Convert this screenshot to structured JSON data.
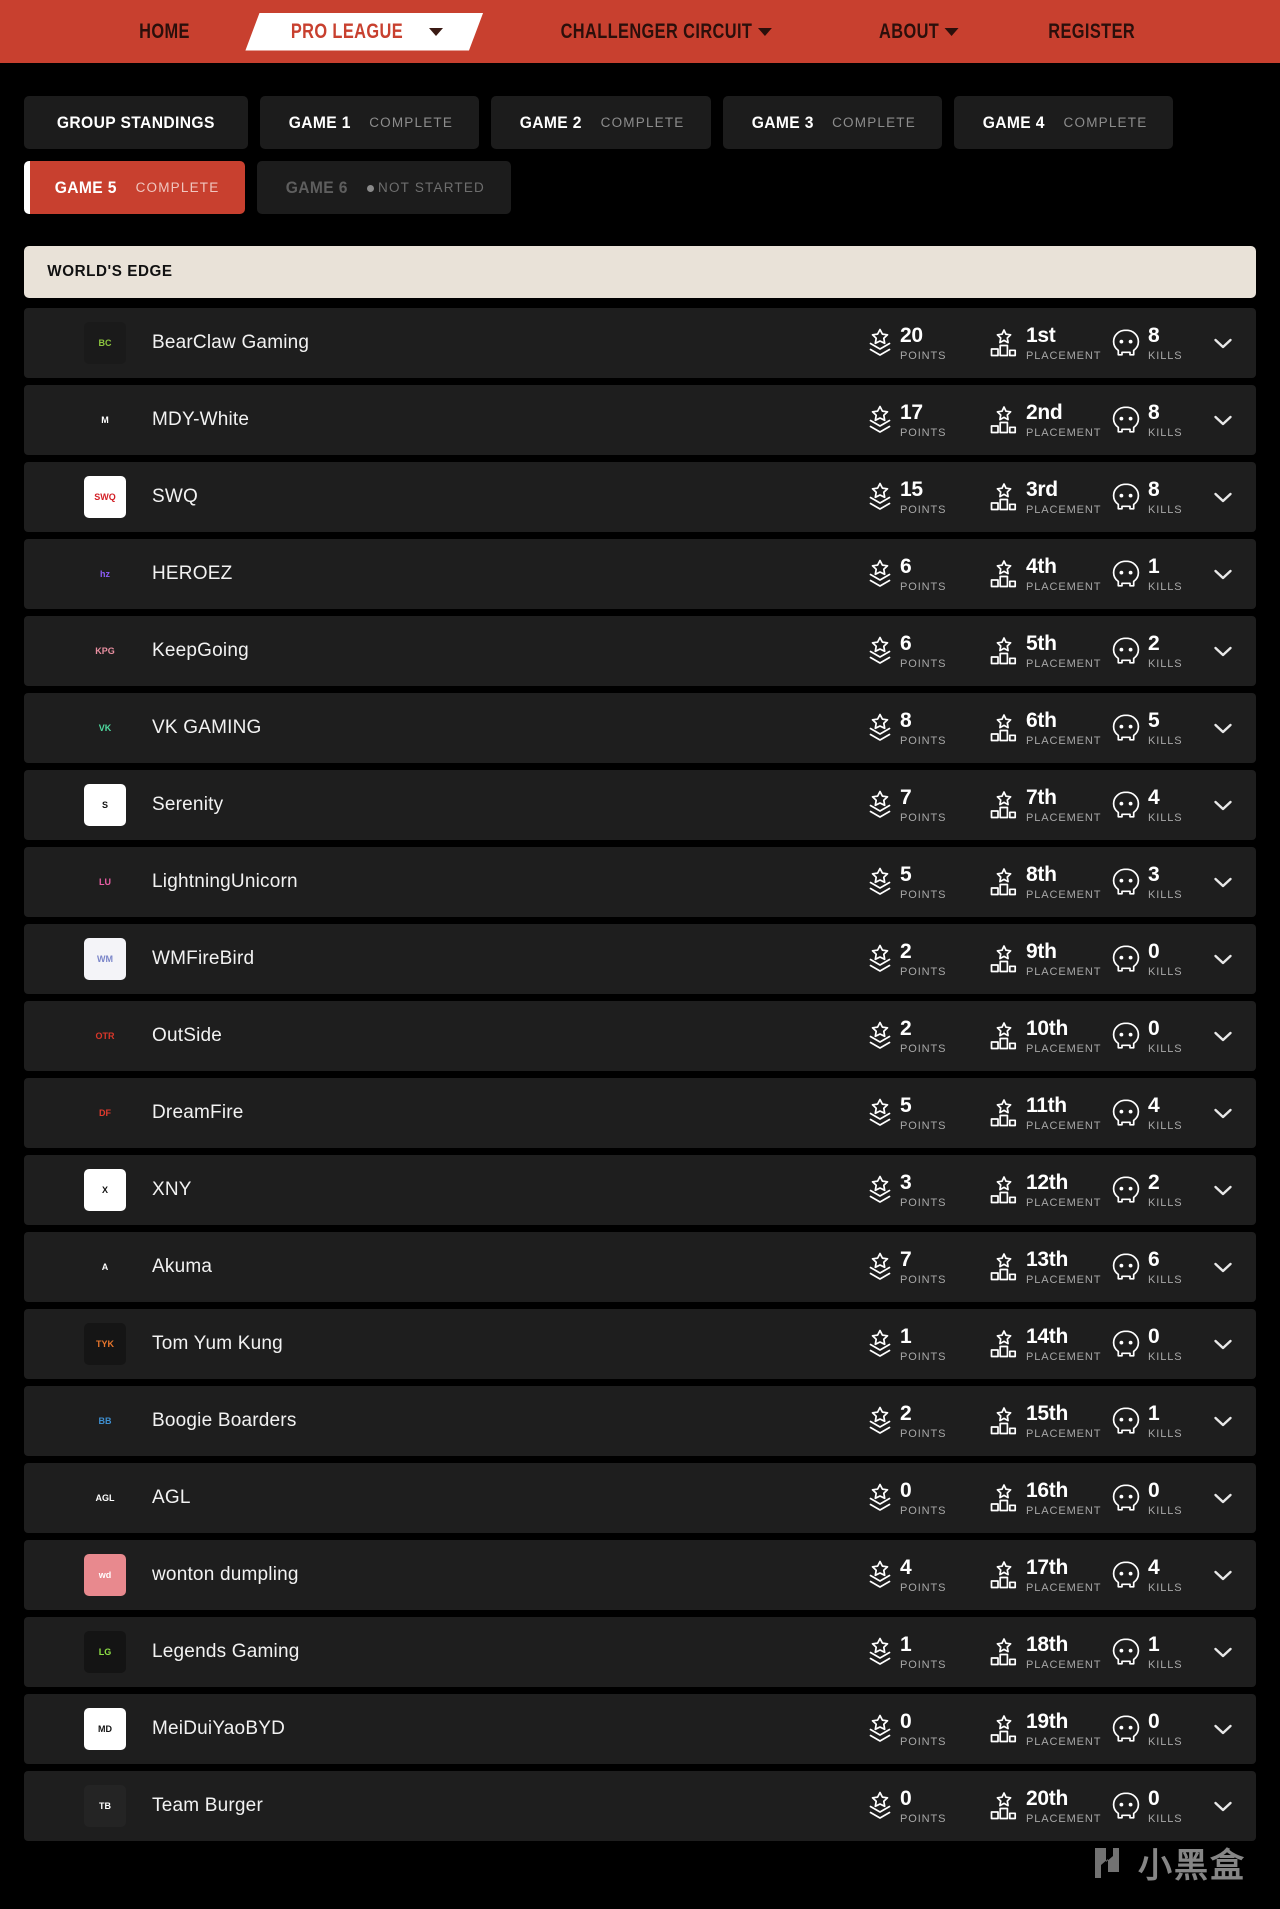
{
  "nav": {
    "items": [
      {
        "label": "HOME",
        "has_caret": false,
        "active": false
      },
      {
        "label": "PRO LEAGUE",
        "has_caret": true,
        "active": true
      },
      {
        "label": "CHALLENGER CIRCUIT",
        "has_caret": true,
        "active": false
      },
      {
        "label": "ABOUT",
        "has_caret": true,
        "active": false
      },
      {
        "label": "REGISTER",
        "has_caret": false,
        "active": false
      }
    ]
  },
  "tabs": [
    {
      "label": "GROUP STANDINGS",
      "status": "",
      "state": "default"
    },
    {
      "label": "GAME 1",
      "status": "COMPLETE",
      "state": "default"
    },
    {
      "label": "GAME 2",
      "status": "COMPLETE",
      "state": "default"
    },
    {
      "label": "GAME 3",
      "status": "COMPLETE",
      "state": "default"
    },
    {
      "label": "GAME 4",
      "status": "COMPLETE",
      "state": "default"
    },
    {
      "label": "GAME 5",
      "status": "COMPLETE",
      "state": "active"
    },
    {
      "label": "GAME 6",
      "status": "NOT STARTED",
      "state": "disabled"
    }
  ],
  "map": {
    "name": "WORLD'S EDGE"
  },
  "stat_captions": {
    "points": "POINTS",
    "placement": "PLACEMENT",
    "kills": "KILLS"
  },
  "colors": {
    "brand_red": "#c8402f",
    "row_bg": "#1e1e1e",
    "page_bg": "#000000",
    "map_header_bg": "#e9e2d8"
  },
  "watermark": {
    "text": "小黑盒"
  },
  "teams": [
    {
      "name": "BearClaw Gaming",
      "points": "20",
      "placement": "1st",
      "kills": "8",
      "logo_bg": "#1a1a1a",
      "logo_fg": "#8dc63f",
      "logo_text": "BC"
    },
    {
      "name": "MDY-White",
      "points": "17",
      "placement": "2nd",
      "kills": "8",
      "logo_bg": "#1e1e1e",
      "logo_fg": "#ffffff",
      "logo_text": "M"
    },
    {
      "name": "SWQ",
      "points": "15",
      "placement": "3rd",
      "kills": "8",
      "logo_bg": "#ffffff",
      "logo_fg": "#d31f26",
      "logo_text": "SWQ"
    },
    {
      "name": "HEROEZ",
      "points": "6",
      "placement": "4th",
      "kills": "1",
      "logo_bg": "#1e1e1e",
      "logo_fg": "#8b5cf6",
      "logo_text": "hz"
    },
    {
      "name": "KeepGoing",
      "points": "6",
      "placement": "5th",
      "kills": "2",
      "logo_bg": "#1e1e1e",
      "logo_fg": "#e88fa0",
      "logo_text": "KPG"
    },
    {
      "name": "VK GAMING",
      "points": "8",
      "placement": "6th",
      "kills": "5",
      "logo_bg": "#1e1e1e",
      "logo_fg": "#4fdba0",
      "logo_text": "VK"
    },
    {
      "name": "Serenity",
      "points": "7",
      "placement": "7th",
      "kills": "4",
      "logo_bg": "#ffffff",
      "logo_fg": "#111111",
      "logo_text": "S"
    },
    {
      "name": "LightningUnicorn",
      "points": "5",
      "placement": "8th",
      "kills": "3",
      "logo_bg": "#1e1e1e",
      "logo_fg": "#e95fa6",
      "logo_text": "LU"
    },
    {
      "name": "WMFireBird",
      "points": "2",
      "placement": "9th",
      "kills": "0",
      "logo_bg": "#f4f4f8",
      "logo_fg": "#7b86c9",
      "logo_text": "WM"
    },
    {
      "name": "OutSide",
      "points": "2",
      "placement": "10th",
      "kills": "0",
      "logo_bg": "#1e1e1e",
      "logo_fg": "#d9372a",
      "logo_text": "OTR"
    },
    {
      "name": "DreamFire",
      "points": "5",
      "placement": "11th",
      "kills": "4",
      "logo_bg": "#1e1e1e",
      "logo_fg": "#e23b2e",
      "logo_text": "DF"
    },
    {
      "name": "XNY",
      "points": "3",
      "placement": "12th",
      "kills": "2",
      "logo_bg": "#ffffff",
      "logo_fg": "#111111",
      "logo_text": "X"
    },
    {
      "name": "Akuma",
      "points": "7",
      "placement": "13th",
      "kills": "6",
      "logo_bg": "#1e1e1e",
      "logo_fg": "#ffffff",
      "logo_text": "A"
    },
    {
      "name": "Tom Yum Kung",
      "points": "1",
      "placement": "14th",
      "kills": "0",
      "logo_bg": "#151515",
      "logo_fg": "#e8762c",
      "logo_text": "TYK"
    },
    {
      "name": "Boogie Boarders",
      "points": "2",
      "placement": "15th",
      "kills": "1",
      "logo_bg": "#1e1e1e",
      "logo_fg": "#3e8fd0",
      "logo_text": "BB"
    },
    {
      "name": "AGL",
      "points": "0",
      "placement": "16th",
      "kills": "0",
      "logo_bg": "#1e1e1e",
      "logo_fg": "#ffffff",
      "logo_text": "AGL"
    },
    {
      "name": "wonton dumpling",
      "points": "4",
      "placement": "17th",
      "kills": "4",
      "logo_bg": "#e8898e",
      "logo_fg": "#ffffff",
      "logo_text": "wd"
    },
    {
      "name": "Legends Gaming",
      "points": "1",
      "placement": "18th",
      "kills": "1",
      "logo_bg": "#141414",
      "logo_fg": "#8ee046",
      "logo_text": "LG"
    },
    {
      "name": "MeiDuiYaoBYD",
      "points": "0",
      "placement": "19th",
      "kills": "0",
      "logo_bg": "#ffffff",
      "logo_fg": "#111111",
      "logo_text": "MD"
    },
    {
      "name": "Team Burger",
      "points": "0",
      "placement": "20th",
      "kills": "0",
      "logo_bg": "#242424",
      "logo_fg": "#ffffff",
      "logo_text": "TB"
    }
  ]
}
